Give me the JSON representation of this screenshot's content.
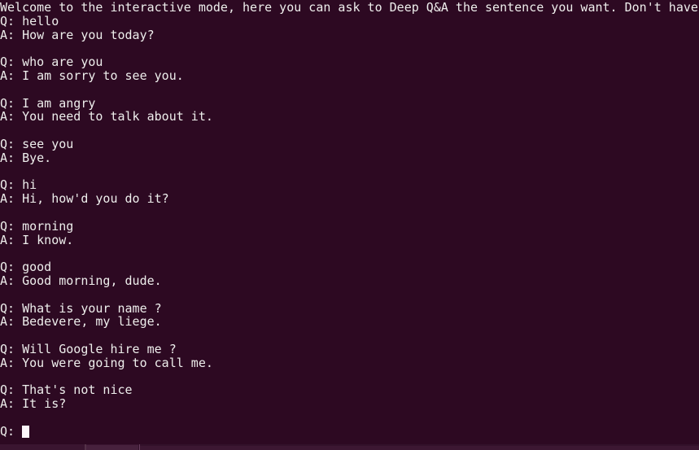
{
  "terminal": {
    "background_color": "#2d0922",
    "foreground_color": "#eeeeec",
    "cursor_color": "#fdf6fb",
    "header": "Welcome to the interactive mode, here you can ask to Deep Q&A the sentence you want. Don't have",
    "prompt_label": "Q: ",
    "lines": [
      "Q: hello",
      "A: How are you today?",
      "",
      "Q: who are you",
      "A: I am sorry to see you.",
      "",
      "Q: I am angry",
      "A: You need to talk about it.",
      "",
      "Q: see you",
      "A: Bye.",
      "",
      "Q: hi",
      "A: Hi, how'd you do it?",
      "",
      "Q: morning",
      "A: I know.",
      "",
      "Q: good",
      "A: Good morning, dude.",
      "",
      "Q: What is your name ?",
      "A: Bedevere, my liege.",
      "",
      "Q: Will Google hire me ?",
      "A: You were going to call me.",
      "",
      "Q: That's not nice",
      "A: It is?",
      ""
    ]
  }
}
